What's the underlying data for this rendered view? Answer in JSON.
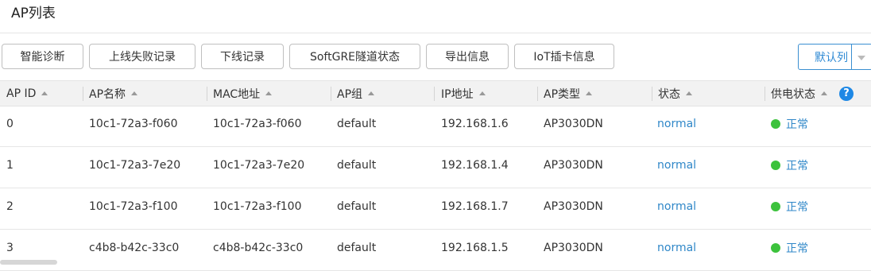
{
  "page": {
    "title": "AP列表"
  },
  "toolbar": {
    "buttons": [
      "智能诊断",
      "上线失败记录",
      "下线记录",
      "SoftGRE隧道状态",
      "导出信息",
      "IoT插卡信息"
    ],
    "columns_label": "默认列"
  },
  "table": {
    "headers": [
      "AP ID",
      "AP名称",
      "MAC地址",
      "AP组",
      "IP地址",
      "AP类型",
      "状态",
      "供电状态"
    ],
    "rows": [
      {
        "id": "0",
        "name": "10c1-72a3-f060",
        "mac": "10c1-72a3-f060",
        "group": "default",
        "ip": "192.168.1.6",
        "type": "AP3030DN",
        "status": "normal",
        "power": "正常"
      },
      {
        "id": "1",
        "name": "10c1-72a3-7e20",
        "mac": "10c1-72a3-7e20",
        "group": "default",
        "ip": "192.168.1.4",
        "type": "AP3030DN",
        "status": "normal",
        "power": "正常"
      },
      {
        "id": "2",
        "name": "10c1-72a3-f100",
        "mac": "10c1-72a3-f100",
        "group": "default",
        "ip": "192.168.1.7",
        "type": "AP3030DN",
        "status": "normal",
        "power": "正常"
      },
      {
        "id": "3",
        "name": "c4b8-b42c-33c0",
        "mac": "c4b8-b42c-33c0",
        "group": "default",
        "ip": "192.168.1.5",
        "type": "AP3030DN",
        "status": "normal",
        "power": "正常"
      }
    ]
  },
  "colors": {
    "accent": "#2f87c8",
    "power_ok": "#3cc23c",
    "help": "#1e88e5"
  },
  "icons": {
    "sort": "sort-asc-icon",
    "help": "help-icon",
    "power": "status-dot-icon"
  }
}
